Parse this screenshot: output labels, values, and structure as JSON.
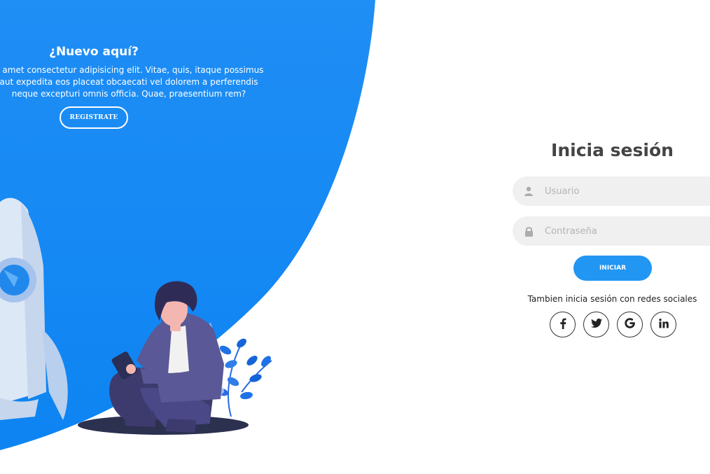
{
  "left_panel": {
    "heading": "¿Nuevo aquí?",
    "paragraph": "it amet consectetur adipisicing elit. Vitae, quis, itaque possimus aut expedita eos placeat obcaecati vel dolorem a perferendis neque excepturi omnis officia. Quae, praesentium rem?",
    "register_label": "REGISTRATE"
  },
  "login": {
    "title": "Inicia sesión",
    "username_placeholder": "Usuario",
    "password_placeholder": "Contraseña",
    "submit_label": "INICIAR",
    "social_prompt": "Tambien inicia sesión con redes sociales",
    "socials": [
      {
        "icon": "facebook-icon",
        "glyph": "f"
      },
      {
        "icon": "twitter-icon",
        "glyph": "t"
      },
      {
        "icon": "google-icon",
        "glyph": "G"
      },
      {
        "icon": "linkedin-icon",
        "glyph": "in"
      }
    ]
  },
  "colors": {
    "primary": "#2196f3",
    "primary_dark": "#0a84f0",
    "field_bg": "#f0f0f0",
    "title": "#444444"
  }
}
